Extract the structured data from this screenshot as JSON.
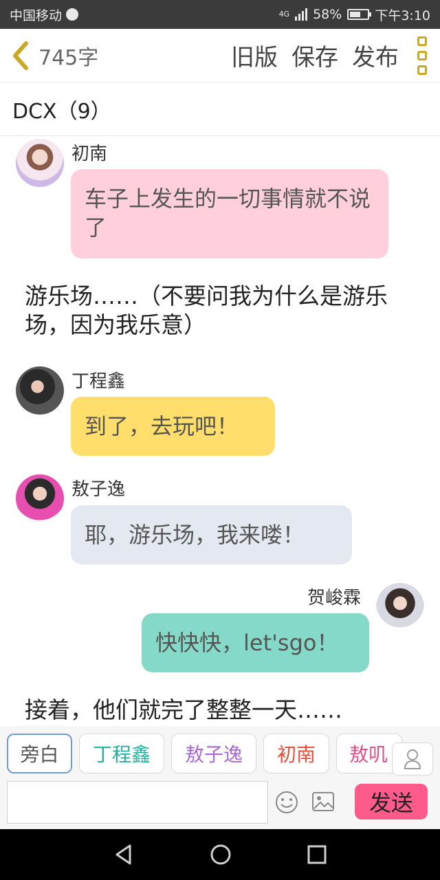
{
  "status_bar": {
    "carrier": "中国移动",
    "network": "4G",
    "battery": "58%",
    "time": "下午3:10"
  },
  "toolbar": {
    "word_count": "745字",
    "old_version": "旧版",
    "save": "保存",
    "publish": "发布"
  },
  "chapter_title": "DCX（9）",
  "messages": [
    {
      "sender": "初南",
      "text": "车子上发生的一切事情就不说了",
      "bubble_color": "#ffd0dc"
    },
    {
      "narration": "游乐场……（不要问我为什么是游乐场，因为我乐意）"
    },
    {
      "sender": "丁程鑫",
      "text": "到了，去玩吧！",
      "bubble_color": "#ffde6b"
    },
    {
      "sender": "敖子逸",
      "text": "耶，游乐场，我来喽！",
      "bubble_color": "#e4e8f0"
    },
    {
      "sender": "贺峻霖",
      "text": "快快快，let'sgo！",
      "bubble_color": "#85d9c8"
    },
    {
      "narration": "接着，他们就完了整整一天……"
    }
  ],
  "characters": [
    {
      "label": "旁白",
      "color": "#555555"
    },
    {
      "label": "丁程鑫",
      "color": "#27b0a0"
    },
    {
      "label": "敖子逸",
      "color": "#a86ad0"
    },
    {
      "label": "初南",
      "color": "#e0503a"
    },
    {
      "label": "敖叽",
      "color": "#e0508a"
    }
  ],
  "send_label": "发送",
  "icons": [
    "back-chevron-icon",
    "more-icon",
    "person-icon",
    "emoji-icon",
    "picture-icon",
    "nav-back-icon",
    "nav-home-icon",
    "nav-recent-icon"
  ]
}
